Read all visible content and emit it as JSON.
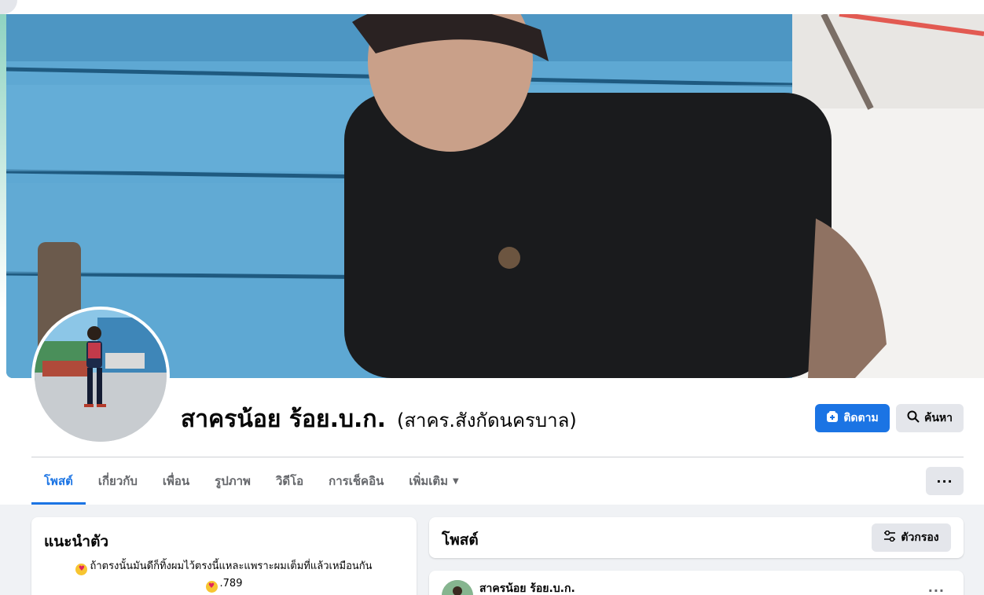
{
  "profile": {
    "name": "สาครน้อย ร้อย.บ.ก.",
    "alternate_name": "(สาคร.สังกัดนครบาล)"
  },
  "actions": {
    "follow_label": "ติดตาม",
    "search_label": "ค้นหา",
    "more_label": "···"
  },
  "tabs": [
    {
      "label": "โพสต์",
      "active": true
    },
    {
      "label": "เกี่ยวกับ",
      "active": false
    },
    {
      "label": "เพื่อน",
      "active": false
    },
    {
      "label": "รูปภาพ",
      "active": false
    },
    {
      "label": "วิดีโอ",
      "active": false
    },
    {
      "label": "การเช็คอิน",
      "active": false
    },
    {
      "label": "เพิ่มเติม",
      "active": false
    }
  ],
  "intro": {
    "title": "แนะนำตัว",
    "bio_line1": "ถ้าตรงนั้นมันดีก็ทิ้งผมไว้ตรงนี้แหละแพราะผมเต็มที่แล้วเหมือนกัน",
    "bio_line2": ".789"
  },
  "posts": {
    "title": "โพสต์",
    "filter_label": "ตัวกรอง",
    "first_post_author": "สาครน้อย ร้อย.บ.ก.",
    "post_menu_label": "···"
  },
  "icons": {
    "follow": "add-friend-icon",
    "search": "search-icon",
    "filter": "filter-sliders-icon",
    "caret": "caret-down-icon",
    "emoji": "heart-eyes-emoji-icon"
  },
  "colors": {
    "accent": "#1b74e4",
    "background": "#f0f2f5",
    "button_gray": "#e4e6eb"
  }
}
